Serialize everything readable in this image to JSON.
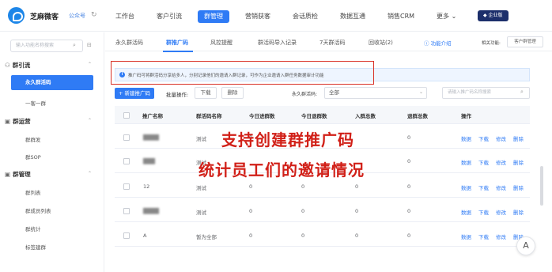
{
  "app": {
    "brand": "芝麻微客",
    "brand_sub": "公众号",
    "enterprise_badge": "企业版"
  },
  "topnav": [
    "工作台",
    "客户引流",
    "群管理",
    "营销获客",
    "会话质检",
    "数据互通",
    "销售CRM",
    "更多"
  ],
  "topnav_active": "群管理",
  "sidebar": {
    "search_placeholder": "输入功能名称搜索",
    "groups": [
      {
        "label": "群引流",
        "items": [
          "永久群活码",
          "一客一群"
        ]
      },
      {
        "label": "群运营",
        "items": [
          "群群发",
          "群SOP"
        ]
      },
      {
        "label": "群管理",
        "items": [
          "群列表",
          "群成员列表",
          "群统计",
          "标签建群"
        ]
      }
    ],
    "active_item": "永久群活码"
  },
  "subtabs": [
    "永久群活码",
    "群推广码",
    "风控提醒",
    "群活码导入记录",
    "7天群活码",
    "回收站(2)"
  ],
  "subtab_active": "群推广码",
  "help_link": "功能介绍",
  "related_label": "相关功能:",
  "related_button": "客户群管理",
  "banner_text": "推广码可将群活码分享给多人，分别记录他们的邀请入群记录，可作为企业邀请入群任务数据审计功能",
  "toolbar": {
    "new_button": "+ 新建推广码",
    "batch_label": "批量操作:",
    "download": "下载",
    "delete": "删除",
    "filter_label": "永久群活码:",
    "filter_value": "全部",
    "search_placeholder": "请输入推广码名称搜索"
  },
  "table": {
    "headers": [
      "推广名称",
      "群活码名称",
      "今日进群数",
      "今日退群数",
      "入群总数",
      "退群总数",
      "操作"
    ],
    "rows": [
      {
        "name": "",
        "code": "测试",
        "today_in": "0",
        "today_out": "",
        "total_in": "",
        "total_out": "0"
      },
      {
        "name": "",
        "code": "测试",
        "today_in": "",
        "today_out": "",
        "total_in": "",
        "total_out": "0"
      },
      {
        "name": "12",
        "code": "测试",
        "today_in": "0",
        "today_out": "0",
        "total_in": "0",
        "total_out": "0"
      },
      {
        "name": "",
        "code": "测试",
        "today_in": "0",
        "today_out": "0",
        "total_in": "0",
        "total_out": "0"
      },
      {
        "name": "A",
        "code": "暂为全部",
        "today_in": "0",
        "today_out": "0",
        "total_in": "0",
        "total_out": "0"
      }
    ],
    "ops": [
      "数据",
      "下载",
      "修改",
      "删除"
    ]
  },
  "overlay": {
    "line1": "支持创建群推广码",
    "line2": "统计员工们的邀请情况"
  },
  "float_button": "A",
  "colors": {
    "accent": "#2f7bf5",
    "annotation": "#d12018",
    "enterprise": "#1c2f6b"
  }
}
